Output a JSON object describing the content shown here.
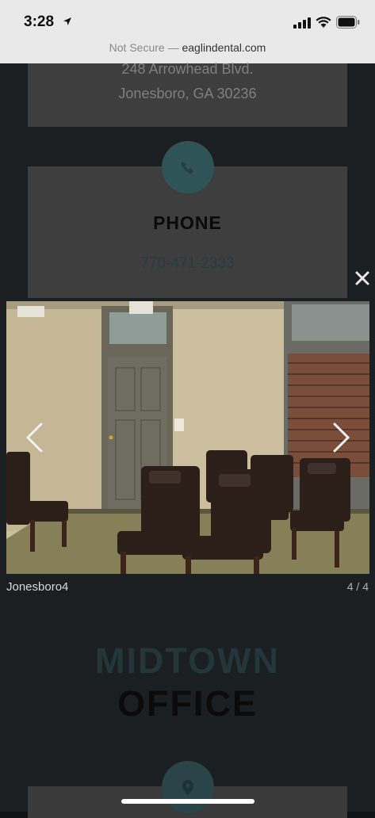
{
  "status_bar": {
    "time": "3:28"
  },
  "browser": {
    "security_label": "Not Secure",
    "separator": " — ",
    "domain": "eaglindental.com"
  },
  "address": {
    "line1": "248 Arrowhead Blvd.",
    "line2": "Jonesboro, GA 30236"
  },
  "phone": {
    "title": "PHONE",
    "number": "770-471-2333"
  },
  "lightbox": {
    "caption": "Jonesboro4",
    "counter": "4 / 4"
  },
  "office": {
    "title_line1": "MIDTOWN",
    "title_line2": "OFFICE"
  },
  "colors": {
    "accent_teal": "#2f5457",
    "overlay": "#101214"
  },
  "icons": {
    "phone": "phone-icon",
    "pin": "map-pin-icon",
    "close": "close-icon",
    "prev": "chevron-left-icon",
    "next": "chevron-right-icon"
  }
}
